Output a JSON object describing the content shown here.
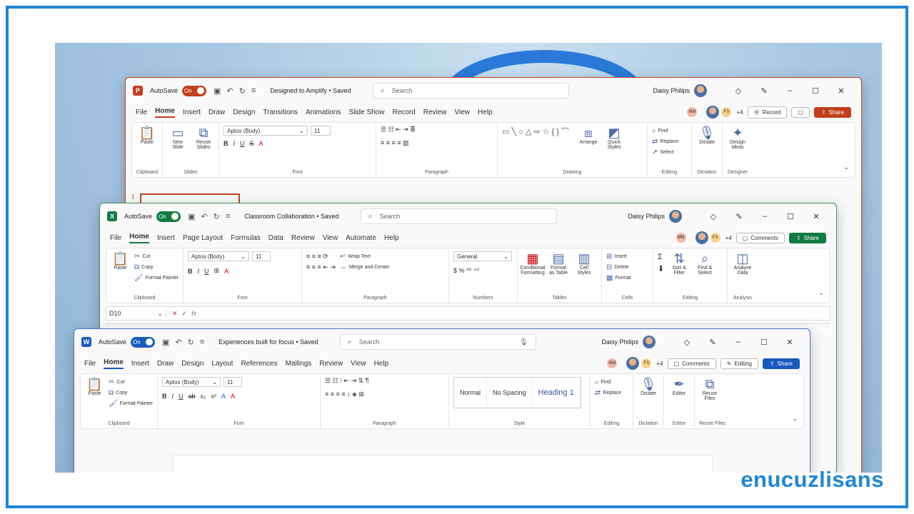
{
  "brand": "enucuzlisans",
  "ppt": {
    "app_letter": "P",
    "autosave": "AutoSave",
    "toggle": "On",
    "title": "Designed to Amplify • Saved",
    "search": "Search",
    "user": "Daisy Philips",
    "tabs": [
      "File",
      "Home",
      "Insert",
      "Draw",
      "Design",
      "Transitions",
      "Animations",
      "Slide Show",
      "Record",
      "Review",
      "View",
      "Help"
    ],
    "collab": {
      "a": "MM",
      "b": "FS",
      "more": "+4",
      "record": "Record",
      "share": "Share"
    },
    "groups": {
      "clipboard": "Clipboard",
      "slides": "Slides",
      "font": "Font",
      "paragraph": "Paragraph",
      "drawing": "Drawing",
      "editing": "Editing",
      "dictation": "Dictation",
      "designer": "Designer"
    },
    "buttons": {
      "paste": "Paste",
      "new_slide": "New Slide",
      "reuse": "Reuse Slides",
      "font_name": "Aptos (Body)",
      "font_size": "11",
      "arrange": "Arrange",
      "quick_styles": "Quick Styles",
      "find": "Find",
      "replace": "Replace",
      "select": "Select",
      "dictate": "Dictate",
      "design_ideas": "Design Ideas"
    },
    "slide_num": "1"
  },
  "xl": {
    "app_letter": "X",
    "autosave": "AutoSave",
    "toggle": "On",
    "title": "Classroom Collaboration • Saved",
    "search": "Search",
    "user": "Daisy Philips",
    "tabs": [
      "File",
      "Home",
      "Insert",
      "Page Layout",
      "Formulas",
      "Data",
      "Review",
      "View",
      "Automate",
      "Help"
    ],
    "collab": {
      "a": "MM",
      "b": "FS",
      "more": "+4",
      "comments": "Comments",
      "share": "Share"
    },
    "groups": {
      "clipboard": "Clipboard",
      "font": "Font",
      "paragraph": "Paragraph",
      "numbers": "Numbers",
      "tables": "Tables",
      "cells": "Cells",
      "editing": "Editing",
      "analysis": "Analysis"
    },
    "buttons": {
      "paste": "Paste",
      "cut": "Cut",
      "copy": "Copy",
      "format_painter": "Format Painter",
      "font_name": "Aptos (Body)",
      "font_size": "11",
      "wrap": "Wrap Text",
      "merge": "Merge and Center",
      "number_format": "General",
      "cond": "Conditional Formatting",
      "format_table": "Format as Table",
      "cell_styles": "Cell Styles",
      "insert": "Insert",
      "delete": "Delete",
      "format": "Format",
      "sort": "Sort & Filter",
      "find": "Find & Select",
      "analyze": "Analyze Data"
    },
    "namebox": "D10",
    "fx": "fx"
  },
  "wd": {
    "app_letter": "W",
    "autosave": "AutoSave",
    "toggle": "On",
    "title": "Experiences built for focus • Saved",
    "search": "Search",
    "user": "Daisy Philips",
    "tabs": [
      "File",
      "Home",
      "Insert",
      "Draw",
      "Design",
      "Layout",
      "References",
      "Mailings",
      "Review",
      "View",
      "Help"
    ],
    "collab": {
      "a": "MM",
      "b": "FS",
      "more": "+4",
      "comments": "Comments",
      "editing": "Editing",
      "share": "Share"
    },
    "groups": {
      "clipboard": "Clipboard",
      "font": "Font",
      "paragraph": "Paragraph",
      "style": "Style",
      "editing": "Editing",
      "dictation": "Dictation",
      "editor": "Editor",
      "reuse": "Reuse Files"
    },
    "buttons": {
      "paste": "Paste",
      "cut": "Cut",
      "copy": "Copy",
      "format_painter": "Format Painter",
      "font_name": "Aptos (Body)",
      "font_size": "11",
      "find": "Find",
      "replace": "Replace",
      "dictate": "Dictate",
      "editor": "Editor",
      "reuse": "Reuse Files"
    },
    "styles": [
      "Normal",
      "No Spacing",
      "Heading 1"
    ]
  },
  "colors": {
    "ppt": "#c43e1c",
    "xl": "#107c41",
    "wd": "#185abd",
    "frame": "#1f86d6"
  }
}
